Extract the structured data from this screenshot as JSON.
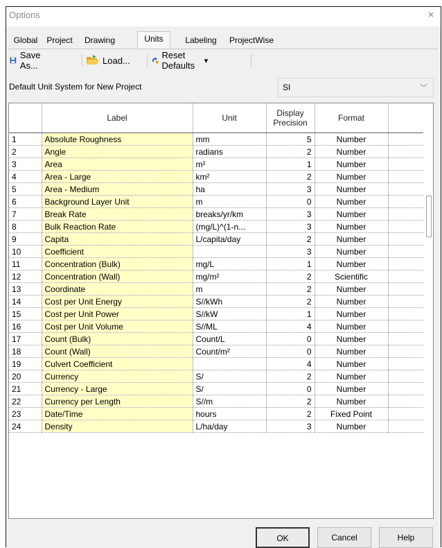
{
  "window": {
    "title": "Options",
    "close_glyph": "×"
  },
  "tabs": [
    {
      "label": "Global",
      "active": false
    },
    {
      "label": "Project",
      "active": false
    },
    {
      "label": "Drawing",
      "active": false
    },
    {
      "label": "Units",
      "active": true
    },
    {
      "label": "Labeling",
      "active": false
    },
    {
      "label": "ProjectWise",
      "active": false
    }
  ],
  "toolbar": {
    "save_as": {
      "label": "Save As...",
      "icon": "floppy-disk-icon"
    },
    "load": {
      "label": "Load...",
      "icon": "open-folder-icon"
    },
    "reset_defaults": {
      "label": "Reset Defaults",
      "icon": "reset-arrow-icon",
      "dropdown": "▾"
    }
  },
  "default_unit_system": {
    "label": "Default Unit System for New Project",
    "value": "SI"
  },
  "columns": {
    "label": "Label",
    "unit": "Unit",
    "precision_line1": "Display",
    "precision_line2": "Precision",
    "format": "Format"
  },
  "rows": [
    {
      "n": "1",
      "label": "Absolute Roughness",
      "unit": "mm",
      "precision": "5",
      "format": "Number"
    },
    {
      "n": "2",
      "label": "Angle",
      "unit": "radians",
      "precision": "2",
      "format": "Number"
    },
    {
      "n": "3",
      "label": "Area",
      "unit": "m²",
      "precision": "1",
      "format": "Number"
    },
    {
      "n": "4",
      "label": "Area - Large",
      "unit": "km²",
      "precision": "2",
      "format": "Number"
    },
    {
      "n": "5",
      "label": "Area - Medium",
      "unit": "ha",
      "precision": "3",
      "format": "Number"
    },
    {
      "n": "6",
      "label": "Background Layer Unit",
      "unit": "m",
      "precision": "0",
      "format": "Number"
    },
    {
      "n": "7",
      "label": "Break Rate",
      "unit": "breaks/yr/km",
      "precision": "3",
      "format": "Number"
    },
    {
      "n": "8",
      "label": "Bulk Reaction Rate",
      "unit": "(mg/L)^(1-n...",
      "precision": "3",
      "format": "Number"
    },
    {
      "n": "9",
      "label": "Capita",
      "unit": "L/capita/day",
      "precision": "2",
      "format": "Number"
    },
    {
      "n": "10",
      "label": "Coefficient",
      "unit": "",
      "precision": "3",
      "format": "Number"
    },
    {
      "n": "11",
      "label": "Concentration (Bulk)",
      "unit": "mg/L",
      "precision": "1",
      "format": "Number"
    },
    {
      "n": "12",
      "label": "Concentration (Wall)",
      "unit": "mg/m²",
      "precision": "2",
      "format": "Scientific"
    },
    {
      "n": "13",
      "label": "Coordinate",
      "unit": "m",
      "precision": "2",
      "format": "Number"
    },
    {
      "n": "14",
      "label": "Cost per Unit Energy",
      "unit": "S//kWh",
      "precision": "2",
      "format": "Number"
    },
    {
      "n": "15",
      "label": "Cost per Unit Power",
      "unit": "S//kW",
      "precision": "1",
      "format": "Number"
    },
    {
      "n": "16",
      "label": "Cost per Unit Volume",
      "unit": "S//ML",
      "precision": "4",
      "format": "Number"
    },
    {
      "n": "17",
      "label": "Count (Bulk)",
      "unit": "Count/L",
      "precision": "0",
      "format": "Number"
    },
    {
      "n": "18",
      "label": "Count (Wall)",
      "unit": "Count/m²",
      "precision": "0",
      "format": "Number"
    },
    {
      "n": "19",
      "label": "Culvert Coefficient",
      "unit": "",
      "precision": "4",
      "format": "Number"
    },
    {
      "n": "20",
      "label": "Currency",
      "unit": "S/",
      "precision": "2",
      "format": "Number"
    },
    {
      "n": "21",
      "label": "Currency - Large",
      "unit": "S/",
      "precision": "0",
      "format": "Number"
    },
    {
      "n": "22",
      "label": "Currency per Length",
      "unit": "S//m",
      "precision": "2",
      "format": "Number"
    },
    {
      "n": "23",
      "label": "Date/Time",
      "unit": "hours",
      "precision": "2",
      "format": "Fixed Point"
    },
    {
      "n": "24",
      "label": "Density",
      "unit": "L/ha/day",
      "precision": "3",
      "format": "Number"
    }
  ],
  "buttons": {
    "ok": "OK",
    "cancel": "Cancel",
    "help": "Help"
  }
}
